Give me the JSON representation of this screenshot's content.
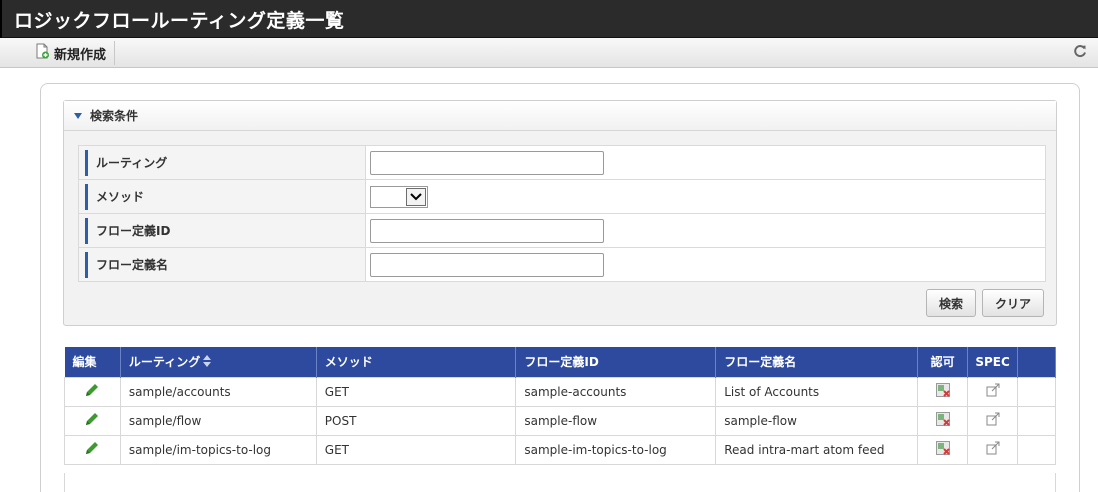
{
  "title": "ロジックフロールーティング定義一覧",
  "toolbar": {
    "new_label": "新規作成"
  },
  "search": {
    "header": "検索条件",
    "fields": [
      {
        "label": "ルーティング",
        "type": "text",
        "value": ""
      },
      {
        "label": "メソッド",
        "type": "select",
        "value": ""
      },
      {
        "label": "フロー定義ID",
        "type": "text",
        "value": ""
      },
      {
        "label": "フロー定義名",
        "type": "text",
        "value": ""
      }
    ],
    "search_button": "検索",
    "clear_button": "クリア"
  },
  "table": {
    "headers": [
      "編集",
      "ルーティング",
      "メソッド",
      "フロー定義ID",
      "フロー定義名",
      "認可",
      "SPEC"
    ],
    "rows": [
      {
        "routing": "sample/accounts",
        "method": "GET",
        "flow_id": "sample-accounts",
        "flow_name": "List of Accounts"
      },
      {
        "routing": "sample/flow",
        "method": "POST",
        "flow_id": "sample-flow",
        "flow_name": "sample-flow"
      },
      {
        "routing": "sample/im-topics-to-log",
        "method": "GET",
        "flow_id": "sample-im-topics-to-log",
        "flow_name": "Read intra-mart atom feed"
      }
    ]
  },
  "icons": {
    "new": "new-document-icon",
    "reload": "reload-icon",
    "collapse": "triangle-down-icon",
    "edit": "pencil-icon",
    "auth": "authorization-icon",
    "spec": "external-link-icon",
    "sort": "sort-icon"
  },
  "colors": {
    "titlebar": "#2b2b2b",
    "header": "#2e4a9e",
    "accent": "#2e5fa6",
    "edit_icon": "#3c9a2e"
  }
}
